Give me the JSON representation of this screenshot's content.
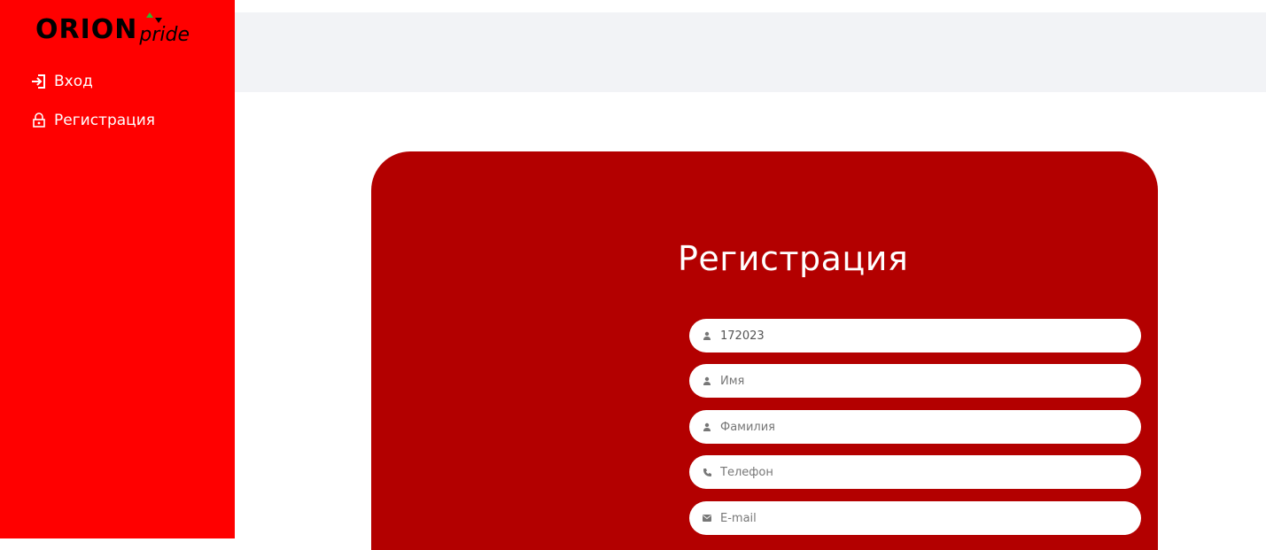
{
  "brand": {
    "name": "ORION",
    "suffix": "pride"
  },
  "sidebar": {
    "items": [
      {
        "label": "Вход",
        "icon": "login-icon"
      },
      {
        "label": "Регистрация",
        "icon": "lock-icon"
      }
    ]
  },
  "form": {
    "title": "Регистрация",
    "fields": [
      {
        "icon": "user-icon",
        "value": "172023",
        "placeholder": ""
      },
      {
        "icon": "user-icon",
        "value": "",
        "placeholder": "Имя"
      },
      {
        "icon": "user-icon",
        "value": "",
        "placeholder": "Фамилия"
      },
      {
        "icon": "phone-icon",
        "value": "",
        "placeholder": "Телефон"
      },
      {
        "icon": "mail-icon",
        "value": "",
        "placeholder": "E-mail"
      }
    ]
  },
  "colors": {
    "sidebar": "#ff0000",
    "card": "#b30000",
    "topbar": "#f2f3f6",
    "logo_accent": "#2eb82e"
  }
}
